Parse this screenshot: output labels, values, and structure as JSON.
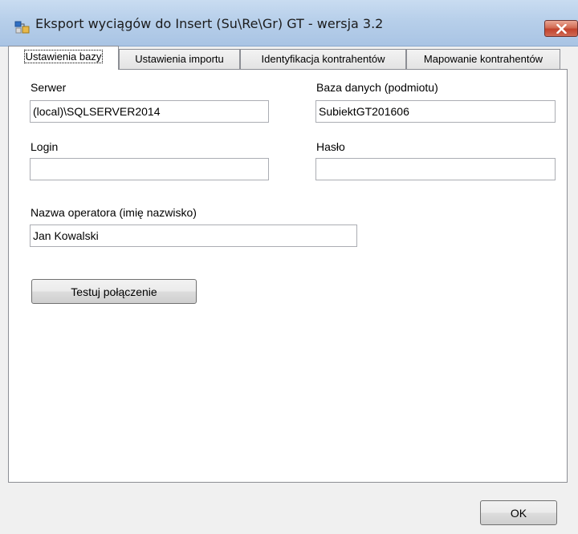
{
  "window": {
    "title": "Eksport wyciągów do Insert (Su\\Re\\Gr) GT - wersja 3.2",
    "icon": "app-window-icon",
    "close_icon": "close-icon",
    "accent": "#a9c4e4",
    "close_color": "#c2422c"
  },
  "tabs": [
    {
      "label": "Ustawienia bazy",
      "active": true
    },
    {
      "label": "Ustawienia importu",
      "active": false
    },
    {
      "label": "Identyfikacja kontrahentów",
      "active": false
    },
    {
      "label": "Mapowanie kontrahentów",
      "active": false
    }
  ],
  "form": {
    "server": {
      "label": "Serwer",
      "value": "(local)\\SQLSERVER2014"
    },
    "database": {
      "label": "Baza danych (podmiotu)",
      "value": "SubiektGT201606"
    },
    "login": {
      "label": "Login",
      "value": ""
    },
    "password": {
      "label": "Hasło",
      "value": ""
    },
    "operator": {
      "label": "Nazwa operatora (imię nazwisko)",
      "value": "Jan Kowalski"
    },
    "test_button": "Testuj połączenie"
  },
  "footer": {
    "ok_button": "OK"
  }
}
